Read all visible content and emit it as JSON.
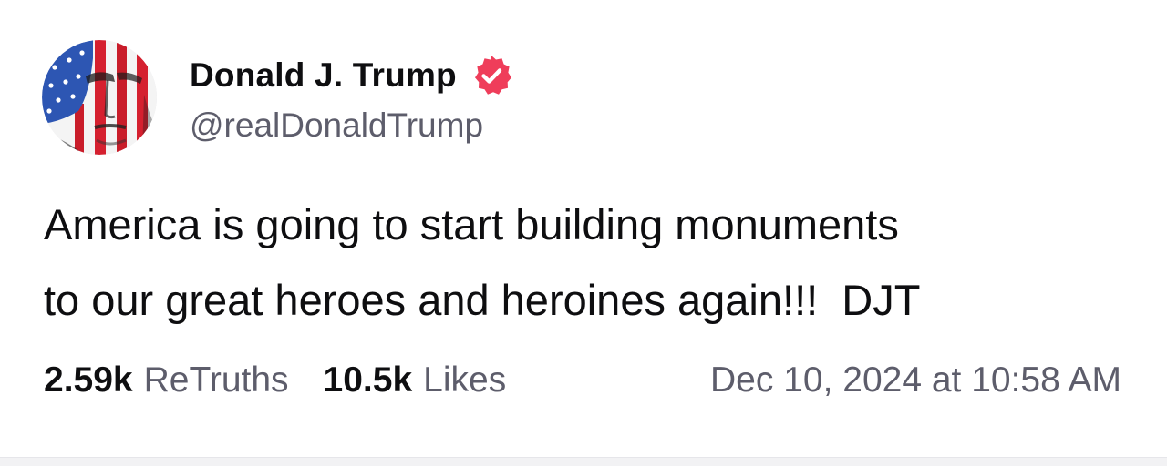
{
  "post": {
    "author": {
      "display_name": "Donald J. Trump",
      "handle": "@realDonaldTrump",
      "verified": true,
      "verified_icon": "verified-badge-icon",
      "avatar": "american-flag-portrait-avatar"
    },
    "text": "America is going to start building monuments\nto our great heroes and heroines again!!!  DJT",
    "stats": {
      "retruths_count": "2.59k",
      "retruths_label": "ReTruths",
      "likes_count": "10.5k",
      "likes_label": "Likes"
    },
    "timestamp": "Dec 10, 2024 at 10:58 AM"
  },
  "colors": {
    "text_primary": "#0e0e10",
    "text_secondary": "#5d5d6b",
    "verified_badge": "#ef3d5a",
    "background": "#ffffff"
  }
}
